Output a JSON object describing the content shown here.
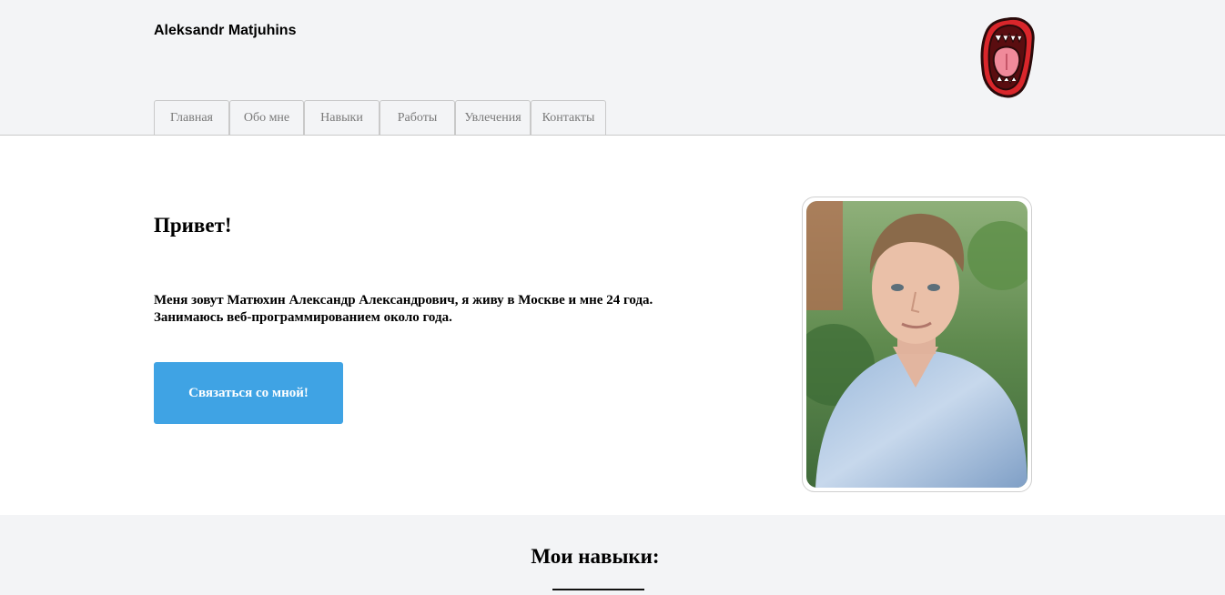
{
  "header": {
    "brand": "Aleksandr Matjuhins",
    "logo_icon": "mouth-tongue-icon"
  },
  "nav": {
    "items": [
      {
        "label": "Главная"
      },
      {
        "label": "Обо мне"
      },
      {
        "label": "Навыки"
      },
      {
        "label": "Работы"
      },
      {
        "label": "Увлечения"
      },
      {
        "label": "Контакты"
      }
    ]
  },
  "hero": {
    "title": "Привет!",
    "text_line1": "Меня зовут Матюхин Александр Александрович, я живу в Москве и мне 24 года.",
    "text_line2": "Занимаюсь веб-программированием около года.",
    "cta_label": "Связаться со мной!"
  },
  "skills": {
    "title": "Мои навыки:"
  },
  "colors": {
    "header_bg": "#f3f4f6",
    "accent": "#3fa3e4",
    "nav_text": "#7a7a7a"
  }
}
